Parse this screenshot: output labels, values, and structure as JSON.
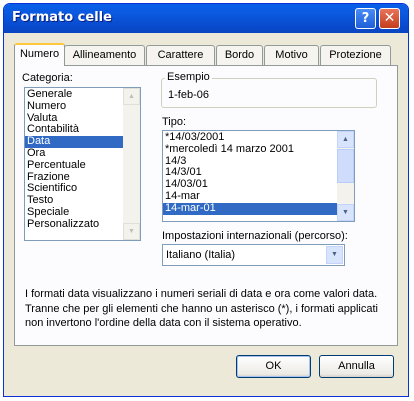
{
  "window": {
    "title": "Formato celle",
    "help_glyph": "?",
    "close_glyph": "✕"
  },
  "tabs": [
    {
      "label": "Numero"
    },
    {
      "label": "Allineamento"
    },
    {
      "label": "Carattere"
    },
    {
      "label": "Bordo"
    },
    {
      "label": "Motivo"
    },
    {
      "label": "Protezione"
    }
  ],
  "categoria": {
    "label": "Categoria:",
    "items": [
      "Generale",
      "Numero",
      "Valuta",
      "Contabilità",
      "Data",
      "Ora",
      "Percentuale",
      "Frazione",
      "Scientifico",
      "Testo",
      "Speciale",
      "Personalizzato"
    ],
    "selected": "Data"
  },
  "esempio": {
    "label": "Esempio",
    "value": "1-feb-06"
  },
  "tipo": {
    "label": "Tipo:",
    "items": [
      "*14/03/2001",
      "*mercoledì 14 marzo 2001",
      "14/3",
      "14/3/01",
      "14/03/01",
      "14-mar",
      "14-mar-01"
    ],
    "selected": "14-mar-01"
  },
  "impostazioni": {
    "label": "Impostazioni internazionali (percorso):",
    "value": "Italiano (Italia)"
  },
  "description": "I formati data visualizzano i numeri seriali di data e ora come valori data. Tranne che per gli elementi che hanno un asterisco (*), i formati applicati non invertono l'ordine della data con il sistema operativo.",
  "buttons": {
    "ok": "OK",
    "cancel": "Annulla"
  },
  "scroll_glyphs": {
    "up": "▲",
    "down": "▼"
  },
  "colors": {
    "titlebar": "#0a5fe8",
    "selection": "#316ac5",
    "dialog_bg": "#ece9d8"
  }
}
